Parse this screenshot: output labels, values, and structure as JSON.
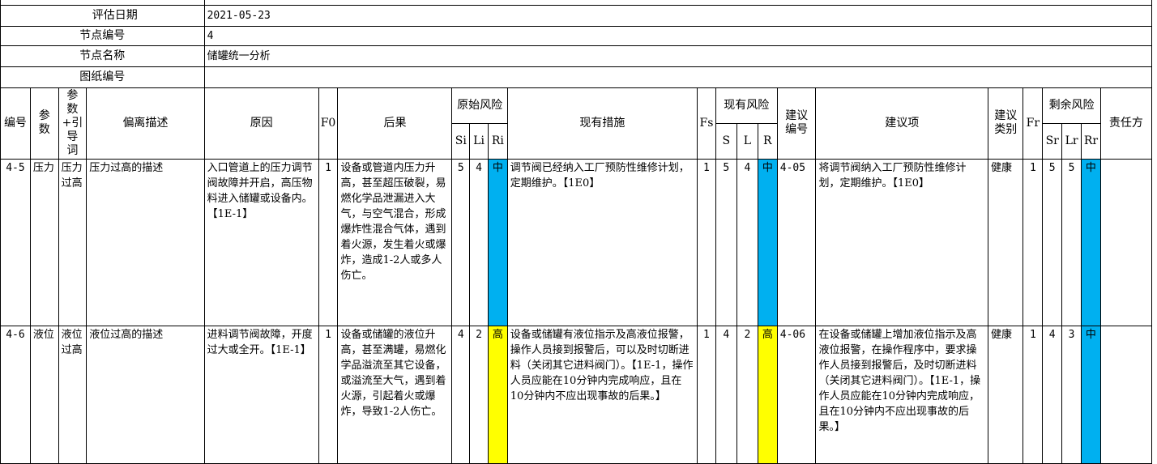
{
  "info": {
    "eval_date_label": "评估日期",
    "eval_date_value": "2021-05-23",
    "node_no_label": "节点编号",
    "node_no_value": "4",
    "node_name_label": "节点名称",
    "node_name_value": "储罐统一分析",
    "drawing_no_label": "图纸编号",
    "drawing_no_value": ""
  },
  "headers": {
    "id": "编号",
    "param": "参数",
    "guideword": "参数+引导词",
    "deviation": "偏离描述",
    "cause": "原因",
    "f0": "F0",
    "consequence": "后果",
    "orig_risk": "原始风险",
    "si": "Si",
    "li": "Li",
    "ri": "Ri",
    "measures": "现有措施",
    "fs": "Fs",
    "cur_risk": "现有风险",
    "s": "S",
    "l": "L",
    "r": "R",
    "rec_no": "建议编号",
    "rec_item": "建议项",
    "rec_type": "建议类别",
    "fr": "Fr",
    "rem_risk": "剩余风险",
    "sr": "Sr",
    "lr": "Lr",
    "rr": "Rr",
    "owner": "责任方"
  },
  "rows": [
    {
      "id": "4-5",
      "param": "压力",
      "guideword": "压力过高",
      "deviation": "压力过高的描述",
      "cause": "入口管道上的压力调节阀故障并开启，高压物料进入储罐或设备内。【1E-1】",
      "f0": "1",
      "consequence": "设备或管道内压力升高，甚至超压破裂，易燃化学品泄漏进入大气，与空气混合，形成爆炸性混合气体，遇到着火源，发生着火或爆炸，造成1-2人或多人伤亡。",
      "si": "5",
      "li": "4",
      "ri": "中",
      "ri_color": "#00b0f0",
      "measures": "调节阀已经纳入工厂预防性维修计划，定期维护。【1E0】",
      "fs": "1",
      "s": "5",
      "l": "4",
      "r": "中",
      "r_color": "#00b0f0",
      "rec_no": "4-05",
      "rec_item": "将调节阀纳入工厂预防性维修计划，定期维护。【1E0】",
      "rec_type": "健康",
      "fr": "1",
      "sr": "5",
      "lr": "5",
      "rr": "中",
      "rr_color": "#00b0f0",
      "owner": ""
    },
    {
      "id": "4-6",
      "param": "液位",
      "guideword": "液位过高",
      "deviation": "液位过高的描述",
      "cause": "进料调节阀故障，开度过大或全开。【1E-1】",
      "f0": "1",
      "consequence": "设备或储罐的液位升高，甚至满罐，易燃化学品溢流至其它设备，或溢流至大气，遇到着火源，引起着火或爆炸，导致1-2人伤亡。",
      "si": "4",
      "li": "2",
      "ri": "高",
      "ri_color": "#ffff00",
      "measures": "设备或储罐有液位指示及高液位报警，操作人员接到报警后，可以及时切断进料（关闭其它进料阀门）。【1E-1，操作人员应能在10分钟内完成响应，且在10分钟内不应出现事故的后果。】",
      "fs": "1",
      "s": "4",
      "l": "2",
      "r": "高",
      "r_color": "#ffff00",
      "rec_no": "4-06",
      "rec_item": "在设备或储罐上增加液位指示及高液位报警，在操作程序中，要求操作人员接到报警后，及时切断进料（关闭其它进料阀门）。【1E-1，操作人员应能在10分钟内完成响应，且在10分钟内不应出现事故的后果。】",
      "rec_type": "健康",
      "fr": "1",
      "sr": "4",
      "lr": "3",
      "rr": "中",
      "rr_color": "#00b0f0",
      "owner": ""
    }
  ]
}
